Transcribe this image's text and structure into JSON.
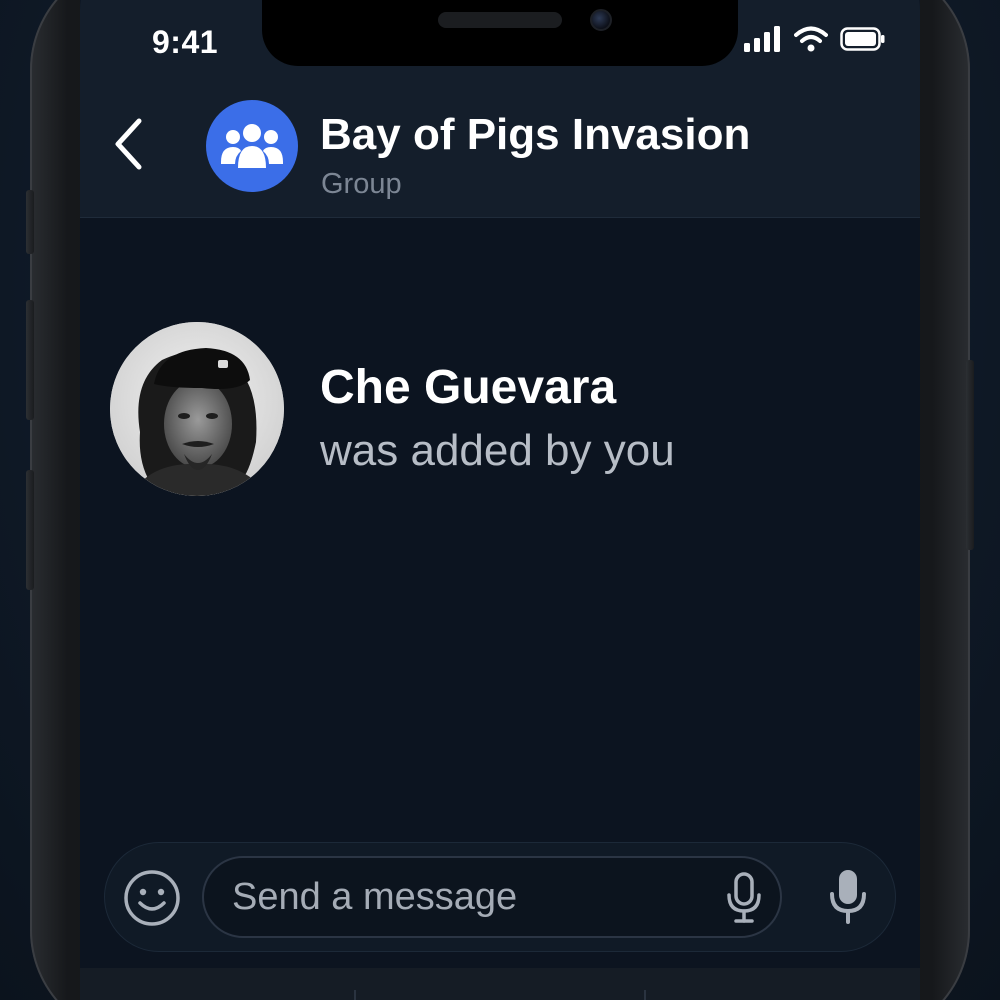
{
  "status_bar": {
    "time": "9:41",
    "icons": [
      "signal-icon",
      "wifi-icon",
      "battery-icon"
    ]
  },
  "header": {
    "title": "Bay of Pigs Invasion",
    "subtitle": "Group",
    "avatar_icon": "group-icon",
    "avatar_color": "#3b6ee8",
    "back_icon": "chevron-left-icon"
  },
  "event": {
    "name": "Che Guevara",
    "text": "was added by you",
    "avatar": "member-photo"
  },
  "composer": {
    "placeholder": "Send a message",
    "emoji_icon": "smiley-icon",
    "input_mic_icon": "microphone-icon",
    "send_mic_icon": "microphone-icon"
  },
  "colors": {
    "background": "#0c1420",
    "header": "#141e2b",
    "accent": "#3b6ee8",
    "text_primary": "#ffffff",
    "text_secondary": "#7c8694"
  }
}
